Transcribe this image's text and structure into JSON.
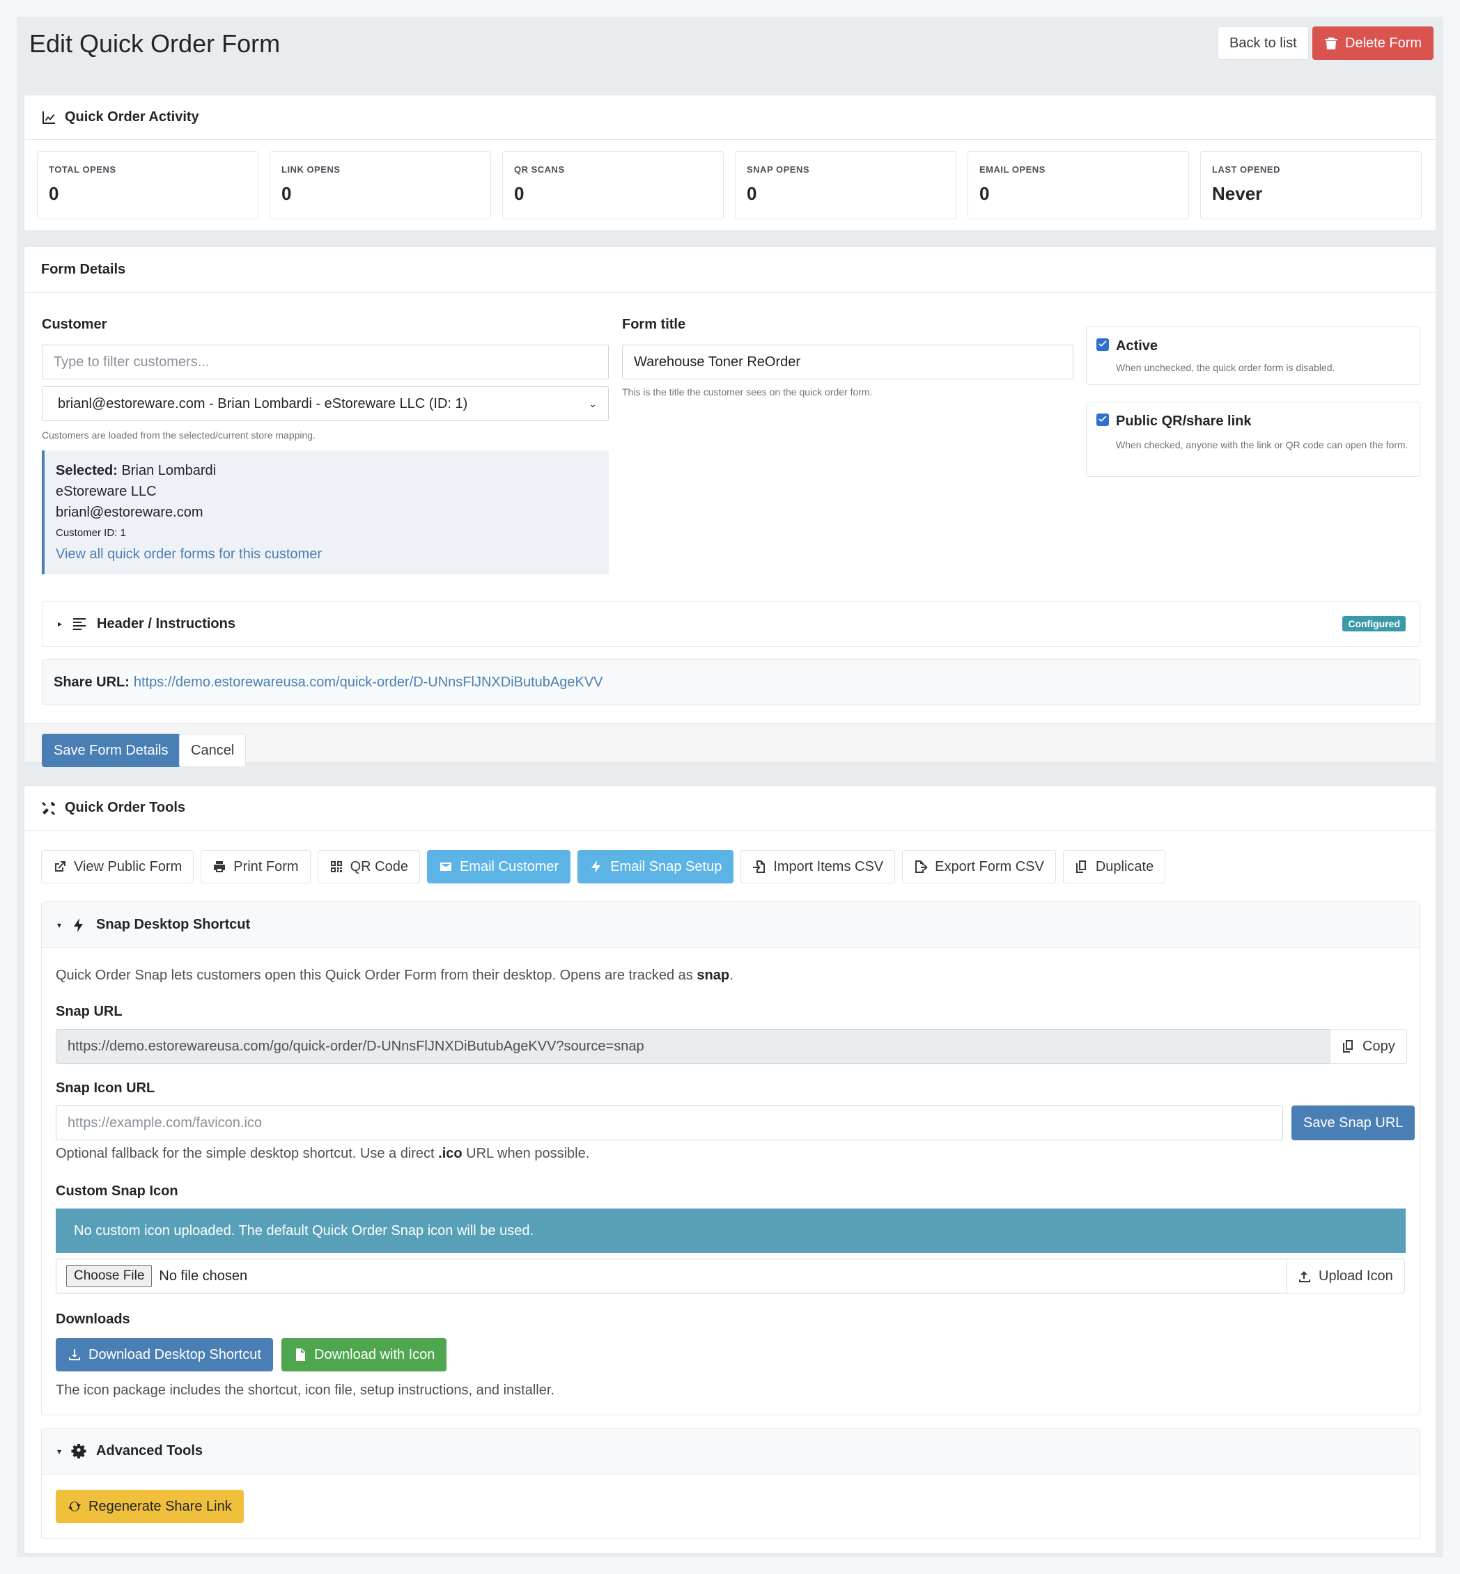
{
  "page": {
    "title": "Edit Quick Order Form",
    "back_label": "Back to list",
    "delete_label": "Delete Form"
  },
  "activity": {
    "title": "Quick Order Activity",
    "stats": [
      {
        "label": "TOTAL OPENS",
        "value": "0"
      },
      {
        "label": "LINK OPENS",
        "value": "0"
      },
      {
        "label": "QR SCANS",
        "value": "0"
      },
      {
        "label": "SNAP OPENS",
        "value": "0"
      },
      {
        "label": "EMAIL OPENS",
        "value": "0"
      },
      {
        "label": "LAST OPENED",
        "value": "Never"
      }
    ]
  },
  "form_details": {
    "title": "Form Details",
    "customer_label": "Customer",
    "customer_filter_placeholder": "Type to filter customers...",
    "customer_selected_option": "brianl@estoreware.com - Brian Lombardi - eStoreware LLC (ID: 1)",
    "customer_help": "Customers are loaded from the selected/current store mapping.",
    "selected_label": "Selected:",
    "selected_name": "Brian Lombardi",
    "selected_company": "eStoreware LLC",
    "selected_email": "brianl@estoreware.com",
    "selected_id": "Customer ID: 1",
    "view_forms_link": "View all quick order forms for this customer",
    "form_title_label": "Form title",
    "form_title_value": "Warehouse Toner ReOrder",
    "form_title_help": "This is the title the customer sees on the quick order form.",
    "active_label": "Active",
    "active_help": "When unchecked, the quick order form is disabled.",
    "public_label": "Public QR/share link",
    "public_help": "When checked, anyone with the link or QR code can open the form.",
    "header_instructions_label": "Header / Instructions",
    "configured_badge": "Configured",
    "share_url_label": "Share URL:",
    "share_url": "https://demo.estorewareusa.com/quick-order/D-UNnsFlJNXDiButubAgeKVV",
    "save_label": "Save Form Details",
    "cancel_label": "Cancel"
  },
  "tools": {
    "title": "Quick Order Tools",
    "buttons": {
      "view_public": "View Public Form",
      "print": "Print Form",
      "qr": "QR Code",
      "email_customer": "Email Customer",
      "email_snap": "Email Snap Setup",
      "import_csv": "Import Items CSV",
      "export_csv": "Export Form CSV",
      "duplicate": "Duplicate"
    },
    "snap": {
      "title": "Snap Desktop Shortcut",
      "intro": "Quick Order Snap lets customers open this Quick Order Form from their desktop. Opens are tracked as",
      "intro_bold": "snap",
      "snap_url_label": "Snap URL",
      "snap_url": "https://demo.estorewareusa.com/go/quick-order/D-UNnsFlJNXDiButubAgeKVV?source=snap",
      "copy_label": "Copy",
      "icon_url_label": "Snap Icon URL",
      "icon_url_placeholder": "https://example.com/favicon.ico",
      "save_snap_label": "Save Snap URL",
      "icon_help_pre": "Optional fallback for the simple desktop shortcut. Use a direct",
      "icon_help_bold": ".ico",
      "icon_help_post": "URL when possible.",
      "custom_icon_label": "Custom Snap Icon",
      "no_icon_alert": "No custom icon uploaded. The default Quick Order Snap icon will be used.",
      "choose_file": "Choose File",
      "no_file": "No file chosen",
      "upload_label": "Upload Icon",
      "downloads_label": "Downloads",
      "download_shortcut": "Download Desktop Shortcut",
      "download_icon": "Download with Icon",
      "downloads_help": "The icon package includes the shortcut, icon file, setup instructions, and installer."
    },
    "advanced": {
      "title": "Advanced Tools",
      "regenerate": "Regenerate Share Link"
    }
  },
  "colors": {
    "primary": "#4a7fb5",
    "info": "#5bb4e5",
    "danger": "#d9534f",
    "success": "#4ea64e",
    "warning": "#f0c03c",
    "alert": "#58a0b8"
  }
}
